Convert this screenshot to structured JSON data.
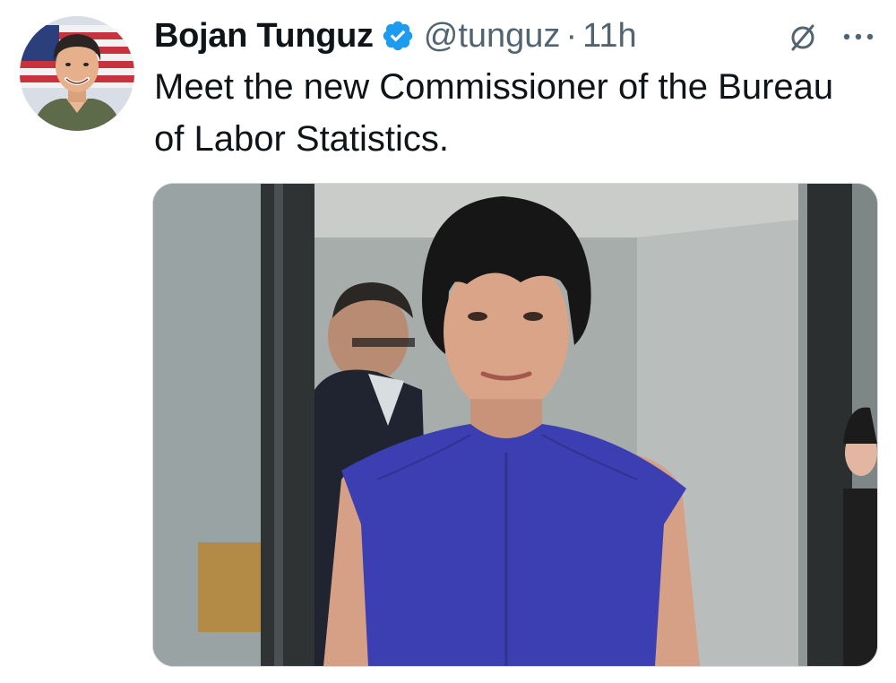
{
  "tweet": {
    "author_name": "Bojan Tunguz",
    "handle": "@tunguz",
    "separator": "·",
    "time": "11h",
    "text": "Meet the new Commissioner of the Bureau of Labor Statistics.",
    "verified": true
  },
  "icons": {
    "verified": "verified-badge-icon",
    "grok": "grok-icon",
    "more": "more-options-icon"
  },
  "colors": {
    "text_primary": "#0f1419",
    "text_secondary": "#536471",
    "verified_blue": "#1d9bf0",
    "dress_blue": "#3b3fb2"
  }
}
